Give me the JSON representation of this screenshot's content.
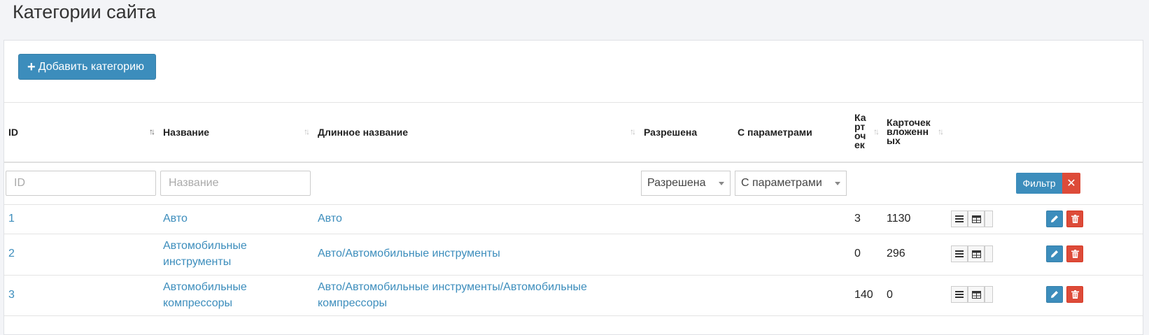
{
  "page_title": "Категории сайта",
  "add_button": {
    "label": "Добавить категорию"
  },
  "columns": {
    "id": "ID",
    "name": "Название",
    "long_name": "Длинное название",
    "allowed": "Разрешена",
    "with_params": "С параметрами",
    "cards": [
      "Ка",
      "рт",
      "оч",
      "ек"
    ],
    "cards_nested": [
      "Карточек",
      "вложенн",
      "ых"
    ]
  },
  "filters": {
    "id_placeholder": "ID",
    "name_placeholder": "Название",
    "allowed_value": "Разрешена",
    "with_params_value": "С параметрами",
    "filter_button": "Фильтр",
    "clear_button": "✕"
  },
  "rows": [
    {
      "id": "1",
      "name": [
        "Авто"
      ],
      "long_name": [
        "Авто"
      ],
      "cards": "3",
      "cards_nested": "1130"
    },
    {
      "id": "2",
      "name": [
        "Автомобильные",
        "инструменты"
      ],
      "long_name": [
        "Авто/Автомобильные инструменты"
      ],
      "cards": "0",
      "cards_nested": "296"
    },
    {
      "id": "3",
      "name": [
        "Автомобильные",
        "компрессоры"
      ],
      "long_name": [
        "Авто/Автомобильные инструменты/Автомобильные",
        "компрессоры"
      ],
      "cards": "140",
      "cards_nested": "0"
    }
  ],
  "colors": {
    "primary": "#3c8dbc",
    "danger": "#dd4b39"
  },
  "icons": {
    "list": "list-icon",
    "table": "table-icon",
    "edit": "pencil-icon",
    "delete": "trash-icon",
    "plus": "plus-icon",
    "clear": "close-icon"
  }
}
